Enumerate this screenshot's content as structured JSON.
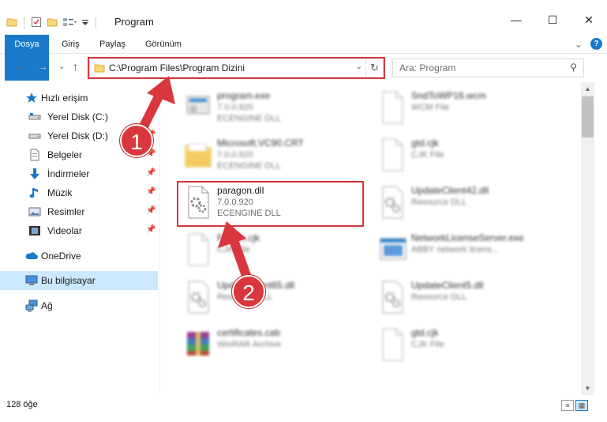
{
  "window": {
    "title": "Program",
    "minimize_glyph": "—",
    "maximize_glyph": "☐",
    "close_glyph": "✕"
  },
  "ribbon": {
    "tabs": [
      "Dosya",
      "Giriş",
      "Paylaş",
      "Görünüm"
    ],
    "expand_glyph": "⌄",
    "help_glyph": "?"
  },
  "nav": {
    "back_glyph": "←",
    "forward_glyph": "→",
    "recent_glyph": "⌄",
    "up_glyph": "↑",
    "address_path": "C:\\Program Files\\Program Dizini",
    "address_drop_glyph": "⌄",
    "refresh_glyph": "↻",
    "search_placeholder": "Ara: Program",
    "search_glyph": "⚲"
  },
  "sidebar": {
    "items": [
      {
        "label": "Hızlı erişim",
        "icon": "star-icon"
      },
      {
        "label": "Yerel Disk (C:)",
        "icon": "drive-icon"
      },
      {
        "label": "Yerel Disk (D:)",
        "icon": "drive-icon"
      },
      {
        "label": "Belgeler",
        "icon": "documents-icon"
      },
      {
        "label": "İndirmeler",
        "icon": "download-icon"
      },
      {
        "label": "Müzik",
        "icon": "music-icon"
      },
      {
        "label": "Resimler",
        "icon": "pictures-icon"
      },
      {
        "label": "Videolar",
        "icon": "videos-icon"
      },
      {
        "label": "OneDrive",
        "icon": "cloud-icon"
      },
      {
        "label": "Bu bilgisayar",
        "icon": "computer-icon"
      },
      {
        "label": "Ağ",
        "icon": "network-icon"
      }
    ],
    "pin_glyph": "📌"
  },
  "files": [
    {
      "name": "program.exe",
      "version": "7.0.0.920",
      "type": "ECENGINE DLL"
    },
    {
      "name": "SndToWP16.wcm",
      "version": "",
      "type": "WCM File"
    },
    {
      "name": "Microsoft.VC90.CRT",
      "version": "7.0.0.920",
      "type": "ECENGINE DLL"
    },
    {
      "name": "gtd.cjk",
      "version": "",
      "type": "CJK File"
    },
    {
      "name": "paragon.dll",
      "version": "7.0.0.920",
      "type": "ECENGINE DLL"
    },
    {
      "name": "UpdateClient42.dll",
      "version": "",
      "type": "Resource DLL"
    },
    {
      "name": "Fzcom.cjk",
      "version": "",
      "type": "CJK File"
    },
    {
      "name": "NetworkLicenseServer.exe",
      "version": "",
      "type": "ABBY network licens..."
    },
    {
      "name": "UpdateClient65.dll",
      "version": "",
      "type": "Resource DLL"
    },
    {
      "name": "UpdateClient5.dll",
      "version": "",
      "type": "Resource DLL"
    },
    {
      "name": "certificates.cab",
      "version": "",
      "type": "WinRAR Archive"
    },
    {
      "name": "gtd.cjk",
      "version": "",
      "type": "CJK File"
    }
  ],
  "status": {
    "item_count": "128 öğe"
  },
  "callouts": [
    "1",
    "2"
  ],
  "colors": {
    "accent": "#1979ca",
    "highlight": "#d9363e",
    "selected": "#cce8ff"
  }
}
